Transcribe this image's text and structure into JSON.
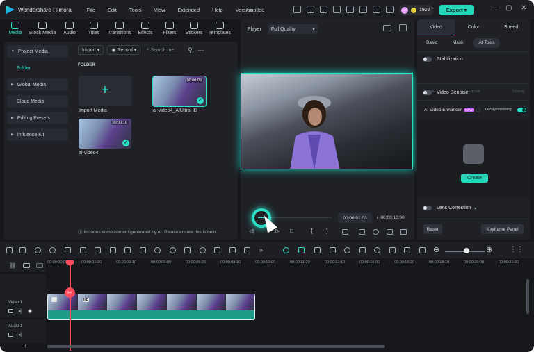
{
  "titlebar": {
    "app_name": "Wondershare Filmora",
    "menu": [
      "File",
      "Edit",
      "Tools",
      "View",
      "Extended",
      "Help",
      "Version"
    ],
    "doc_title": "Untitled",
    "credits": "1922",
    "export_label": "Export",
    "window_controls": [
      "—",
      "▢",
      "✕"
    ]
  },
  "toolbar": {
    "items": [
      {
        "label": "Media",
        "icon": "media-icon"
      },
      {
        "label": "Stock Media",
        "icon": "stock-media-icon"
      },
      {
        "label": "Audio",
        "icon": "audio-icon"
      },
      {
        "label": "Titles",
        "icon": "titles-icon"
      },
      {
        "label": "Transitions",
        "icon": "transitions-icon"
      },
      {
        "label": "Effects",
        "icon": "effects-icon"
      },
      {
        "label": "Filters",
        "icon": "filters-icon"
      },
      {
        "label": "Stickers",
        "icon": "stickers-icon"
      },
      {
        "label": "Templates",
        "icon": "templates-icon"
      }
    ]
  },
  "sidebar": {
    "items": [
      {
        "label": "Project Media"
      },
      {
        "label": "Folder"
      },
      {
        "label": "Global Media"
      },
      {
        "label": "Cloud Media"
      },
      {
        "label": "Editing Presets"
      },
      {
        "label": "Influence Kit"
      }
    ]
  },
  "media": {
    "import_label": "Import",
    "record_label": "Record",
    "search_placeholder": "Search me...",
    "folder_label": "FOLDER",
    "import_media_label": "Import Media",
    "clips": [
      {
        "name": "ai-video4_AIUltraHD",
        "duration": "00:00:09"
      },
      {
        "name": "ai-video4",
        "duration": "00:00:10"
      }
    ],
    "ai_note": "Includes some content generated by AI. Please ensure this is bein..."
  },
  "player": {
    "label": "Player",
    "quality": "Full Quality",
    "current_time": "00:00:01:03",
    "separator": "/",
    "total_time": "00:00:10:00",
    "progress": 0.11,
    "controls": [
      "◁|",
      "▷",
      "□",
      "{",
      "}"
    ]
  },
  "right_panel": {
    "tabs": [
      "Video",
      "Color",
      "Speed"
    ],
    "subtabs": [
      "Basic",
      "Mask",
      "AI Tools"
    ],
    "stabilization": "Stabilization",
    "stab_options": [
      "Weak",
      "Normal",
      "Strong"
    ],
    "video_denoise": "Video Denoise",
    "ai_video_enhancer": "AI Video Enhancer",
    "badge": "NEW",
    "local_processing": "Local processing",
    "create_label": "Create",
    "lens_correction": "Lens Correction",
    "reset_label": "Reset",
    "keyframe_label": "Keyframe Panel"
  },
  "timeline": {
    "ruler": [
      "00:00:00:00",
      "00:00:01:20",
      "00:00:03:10",
      "00:00:05:00",
      "00:00:06:20",
      "00:00:08:10",
      "00:00:10:00",
      "00:00:11:20",
      "00:00:13:10",
      "00:00:15:00",
      "00:00:16:20",
      "00:00:18:10",
      "00:00:20:00",
      "00:00:21:20"
    ],
    "tracks": [
      {
        "label": "Video 1"
      },
      {
        "label": "Audio 1"
      }
    ],
    "clip_badge": "HD"
  },
  "colors": {
    "accent": "#2fe0c8",
    "playhead": "#ff4b5c",
    "background": "#17181c"
  }
}
